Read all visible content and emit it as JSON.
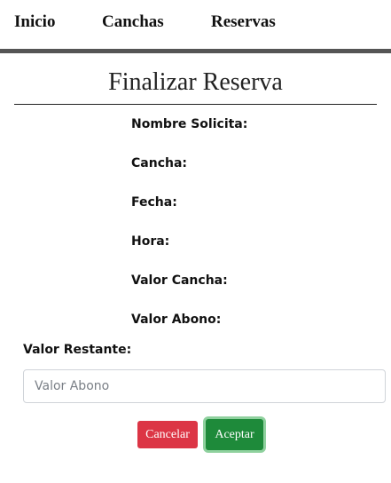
{
  "nav": {
    "items": [
      {
        "label": "Inicio"
      },
      {
        "label": "Canchas"
      },
      {
        "label": "Reservas"
      }
    ]
  },
  "page": {
    "title": "Finalizar Reserva"
  },
  "form": {
    "fields": [
      {
        "label": "Nombre Solicita:"
      },
      {
        "label": "Cancha:"
      },
      {
        "label": "Fecha:"
      },
      {
        "label": "Hora:"
      },
      {
        "label": "Valor Cancha:"
      },
      {
        "label": "Valor Abono:"
      }
    ],
    "restante_label": "Valor Restante:",
    "abono_input": {
      "value": "",
      "placeholder": "Valor Abono"
    },
    "cancel_label": "Cancelar",
    "accept_label": "Aceptar"
  },
  "colors": {
    "cancel": "#dc3545",
    "accept": "#1e8a3a",
    "accept_focus_ring": "#8fd19e",
    "navbar_border": "#555555"
  }
}
